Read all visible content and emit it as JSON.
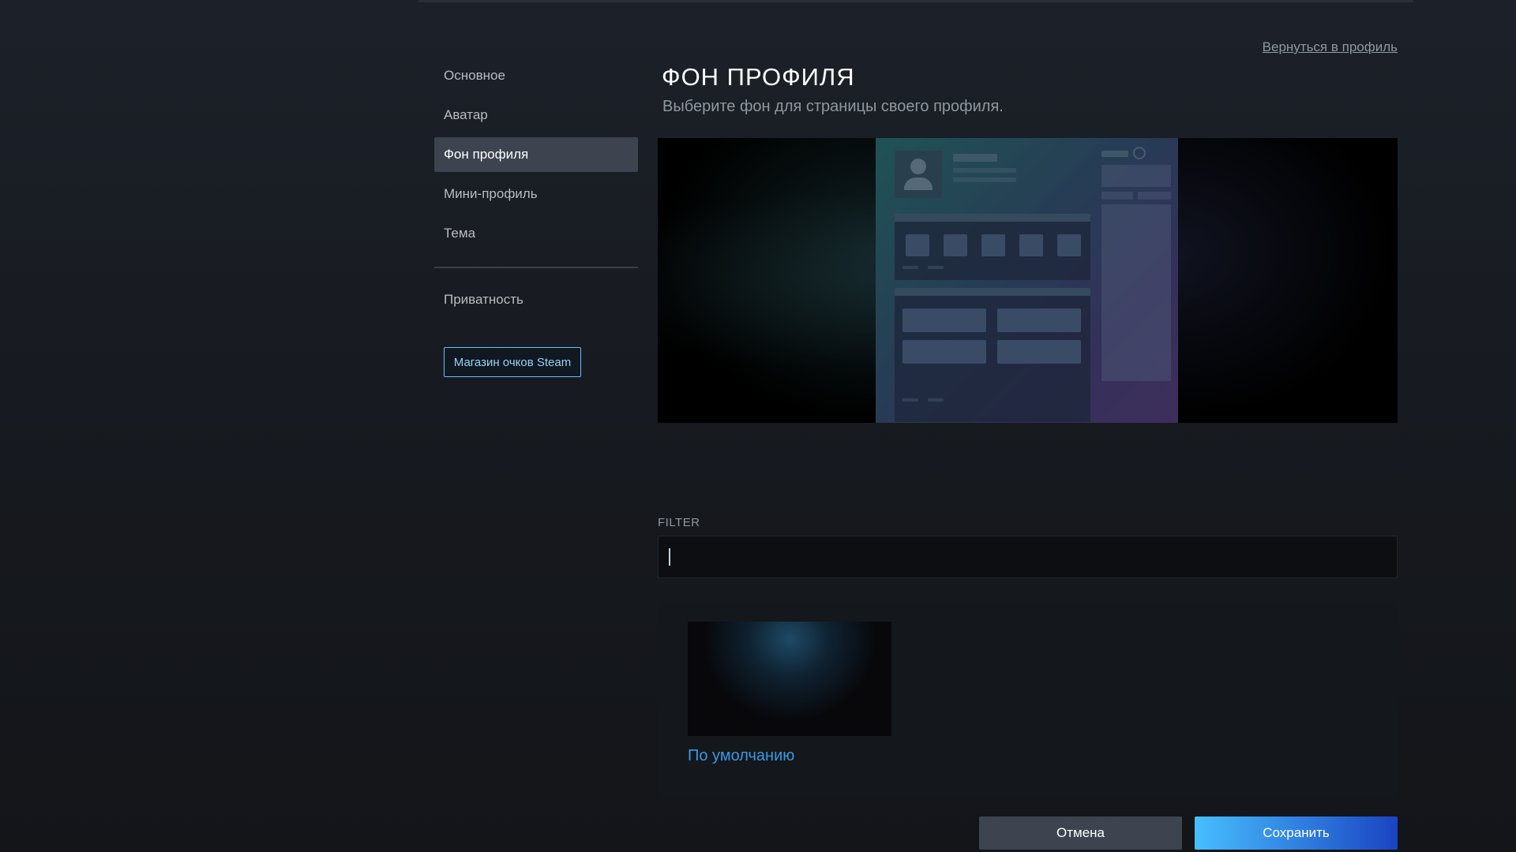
{
  "sidebar": {
    "items": [
      {
        "label": "Основное",
        "active": false
      },
      {
        "label": "Аватар",
        "active": false
      },
      {
        "label": "Фон профиля",
        "active": true
      },
      {
        "label": "Мини-профиль",
        "active": false
      },
      {
        "label": "Тема",
        "active": false
      },
      {
        "label": "Приватность",
        "active": false
      }
    ],
    "shop_button_label": "Магазин очков Steam"
  },
  "header": {
    "back_link": "Вернуться в профиль",
    "title": "ФОН ПРОФИЛЯ",
    "subtitle": "Выберите фон для страницы своего профиля."
  },
  "filter": {
    "label": "FILTER",
    "value": ""
  },
  "backgrounds": [
    {
      "name": "По умолчанию"
    }
  ],
  "actions": {
    "cancel_label": "Отмена",
    "save_label": "Сохранить"
  },
  "colors": {
    "accent": "#66c0f4",
    "link": "#3a98e3",
    "active_item": "#3d4450",
    "save_gradient_start": "#47bfff",
    "save_gradient_end": "#1a44c2"
  }
}
